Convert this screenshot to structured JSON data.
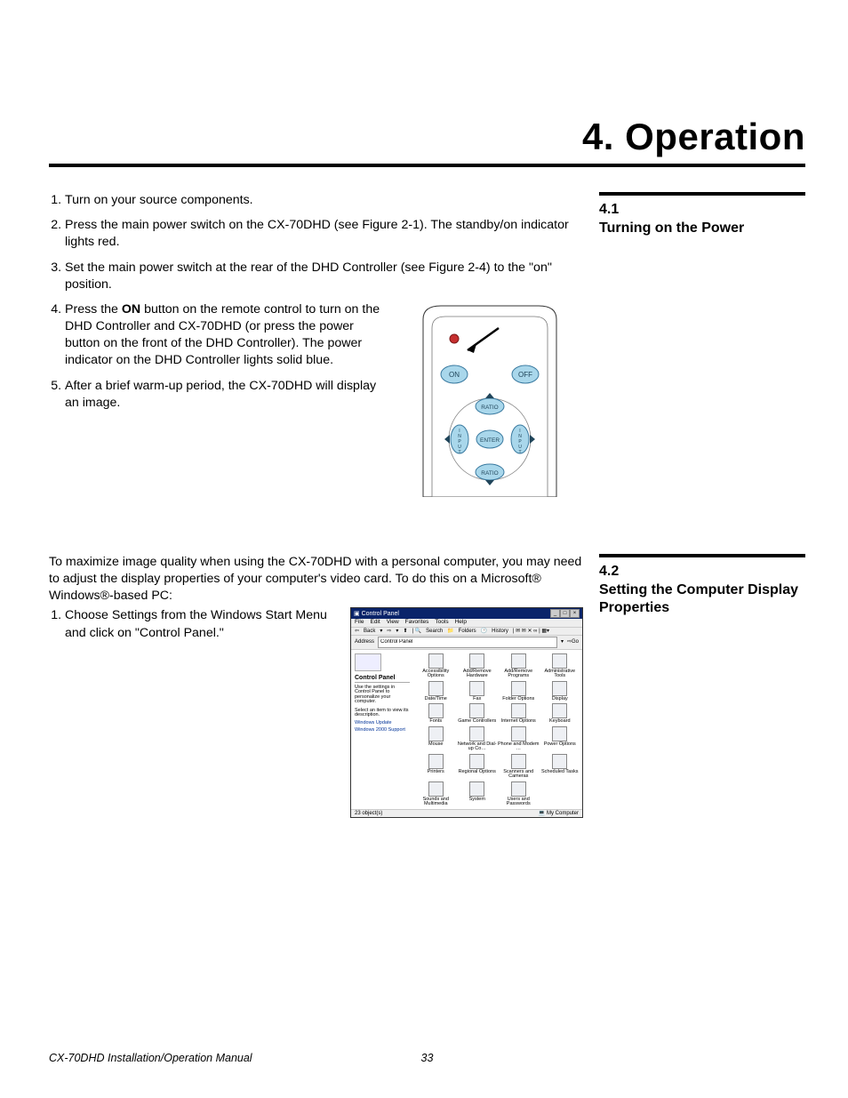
{
  "chapter": {
    "label": "4. Operation"
  },
  "section41": {
    "num": "4.1",
    "title": "Turning on the Power",
    "step1": "Turn on your source components.",
    "step2": "Press the main power switch on the CX-70DHD (see Figure 2-1). The standby/on indicator lights red.",
    "step3": "Set the main power switch at the rear of the DHD Controller (see Figure 2-4) to the \"on\" position.",
    "step4_a": "Press the ",
    "step4_bold": "ON",
    "step4_b": " button on the remote control to turn on the DHD Controller and CX-70DHD (or press the power button on the front of the DHD Controller). The power indicator on the DHD Controller lights solid blue.",
    "step5": "After a brief warm-up period, the CX-70DHD will display an image."
  },
  "remote": {
    "on": "ON",
    "off": "OFF",
    "ratio_top": "RATIO",
    "ratio_bottom": "RATIO",
    "enter": "ENTER",
    "input_l": "INPUT",
    "input_r": "INPUT"
  },
  "section42": {
    "num": "4.2",
    "title": "Setting the Computer Display Properties",
    "intro": "To maximize image quality when using the CX-70DHD with a personal computer, you may need to adjust the display properties of your computer's video card. To do this on a Microsoft® Windows®-based PC:",
    "step1": "Choose Settings from the Windows Start Menu and click on \"Control Panel.\""
  },
  "cp": {
    "title": "Control Panel",
    "menu": [
      "File",
      "Edit",
      "View",
      "Favorites",
      "Tools",
      "Help"
    ],
    "tool_back": "Back",
    "tool_search": "Search",
    "tool_folders": "Folders",
    "tool_history": "History",
    "addr_label": "Address",
    "addr_value": "Control Panel",
    "go": "Go",
    "side_title": "Control Panel",
    "side_desc": "Use the settings in Control Panel to personalize your computer.",
    "side_sel": "Select an item to view its description.",
    "side_link1": "Windows Update",
    "side_link2": "Windows 2000 Support",
    "items": [
      "Accessibility Options",
      "Add/Remove Hardware",
      "Add/Remove Programs",
      "Administrative Tools",
      "Date/Time",
      "Fax",
      "Folder Options",
      "Display",
      "Fonts",
      "Game Controllers",
      "Internet Options",
      "Keyboard",
      "Mouse",
      "Network and Dial-up Co…",
      "Phone and Modem …",
      "Power Options",
      "Printers",
      "Regional Options",
      "Scanners and Cameras",
      "Scheduled Tasks",
      "Sounds and Multimedia",
      "System",
      "Users and Passwords"
    ],
    "status_count": "23 object(s)",
    "status_loc": "My Computer"
  },
  "footer": {
    "doc": "CX-70DHD Installation/Operation Manual",
    "page": "33"
  }
}
